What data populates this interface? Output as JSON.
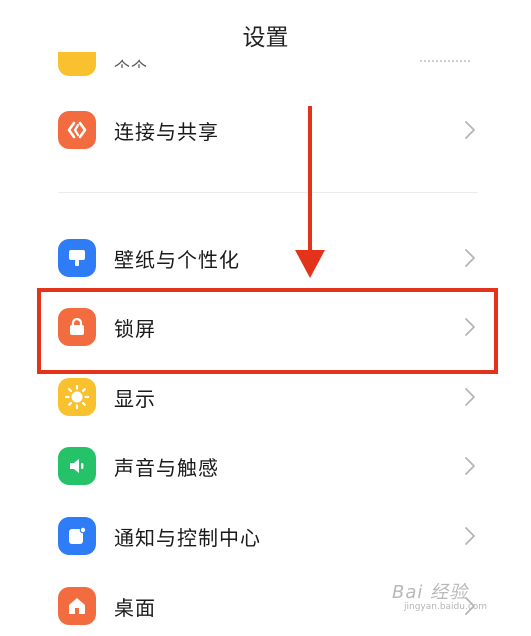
{
  "header": {
    "title": "设置"
  },
  "partial_top": {
    "label": "个个……"
  },
  "items": [
    {
      "label": "连接与共享",
      "icon": "connection-share-icon",
      "color": "#f26c3f"
    },
    {
      "label": "壁纸与个性化",
      "icon": "wallpaper-icon",
      "color": "#2e7cf6"
    },
    {
      "label": "锁屏",
      "icon": "lock-icon",
      "color": "#f26c3f"
    },
    {
      "label": "显示",
      "icon": "sun-icon",
      "color": "#f9c12e"
    },
    {
      "label": "声音与触感",
      "icon": "speaker-icon",
      "color": "#26c26a"
    },
    {
      "label": "通知与控制中心",
      "icon": "notification-icon",
      "color": "#2e7cf6"
    },
    {
      "label": "桌面",
      "icon": "home-icon",
      "color": "#f26c3f"
    }
  ],
  "annotation": {
    "highlight_color": "#e3341b"
  },
  "watermark": {
    "text": "Bai 经验",
    "url": "jingyan.baidu.com"
  }
}
